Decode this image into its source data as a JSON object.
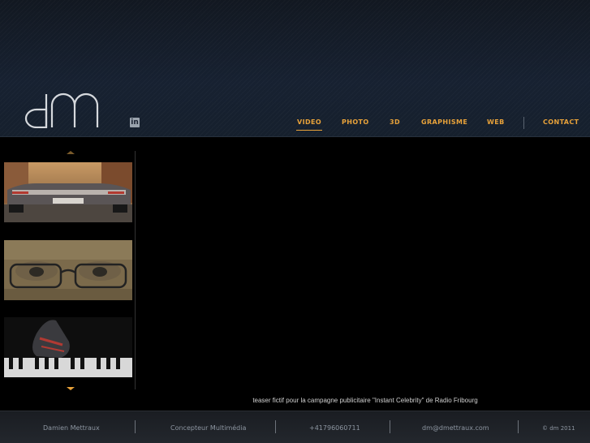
{
  "brand": {
    "logo_text": "dm",
    "linkedin_icon": "in"
  },
  "nav": {
    "items": [
      {
        "label": "VIDEO",
        "active": true
      },
      {
        "label": "PHOTO",
        "active": false
      },
      {
        "label": "3D",
        "active": false
      },
      {
        "label": "GRAPHISME",
        "active": false
      },
      {
        "label": "WEB",
        "active": false
      },
      {
        "label": "CONTACT",
        "active": false
      }
    ]
  },
  "sidebar": {
    "thumbnails": [
      {
        "name": "car-thumbnail",
        "subject": "classic car rear"
      },
      {
        "name": "glasses-thumbnail",
        "subject": "face with glasses"
      },
      {
        "name": "shoe-thumbnail",
        "subject": "shoe on piano keys"
      }
    ]
  },
  "main": {
    "caption": "teaser fictif pour la campagne publicitaire \"Instant Celebrity\" de Radio Fribourg"
  },
  "footer": {
    "name": "Damien Mettraux",
    "role": "Concepteur Multimédia",
    "phone": "+41796060711",
    "email": "dm@dmettraux.com",
    "copyright": "© dm 2011"
  },
  "colors": {
    "accent": "#e8a23a",
    "header_bg": "#172131",
    "footer_text": "#8d96a1"
  }
}
